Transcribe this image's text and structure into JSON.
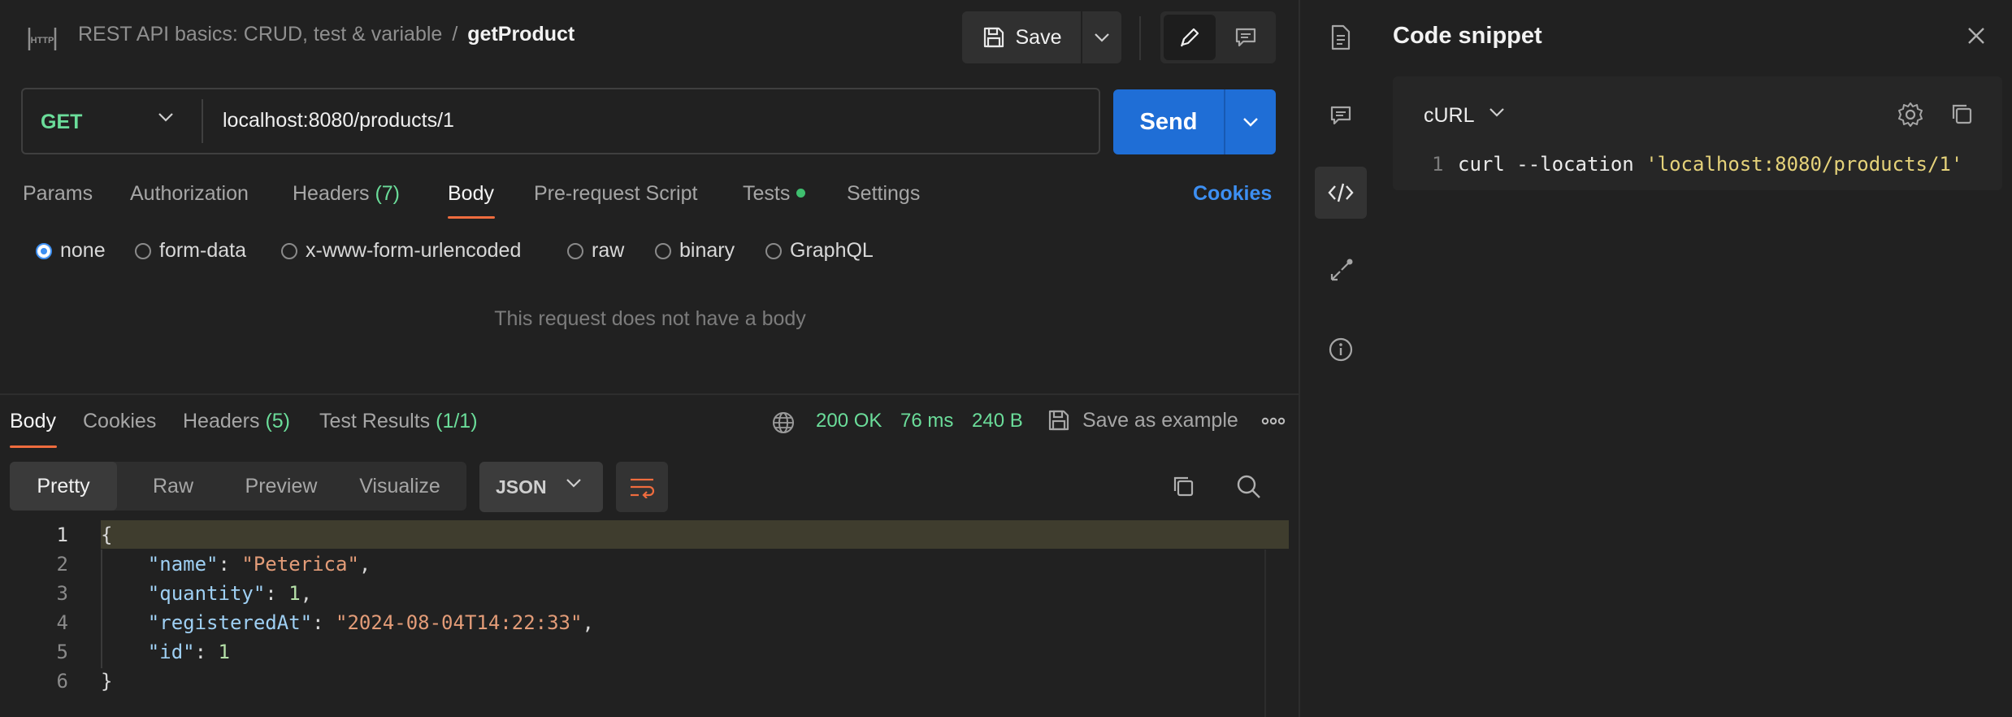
{
  "breadcrumb": {
    "collection": "REST API basics: CRUD, test & variable",
    "separator": "/",
    "request": "getProduct"
  },
  "toolbar": {
    "save_label": "Save"
  },
  "request": {
    "method": "GET",
    "url": "localhost:8080/products/1",
    "send_label": "Send",
    "tabs": {
      "params": "Params",
      "authorization": "Authorization",
      "headers": "Headers",
      "headers_count": "(7)",
      "body": "Body",
      "prerequest": "Pre-request Script",
      "tests": "Tests",
      "settings": "Settings"
    },
    "cookies_label": "Cookies",
    "body_types": [
      "none",
      "form-data",
      "x-www-form-urlencoded",
      "raw",
      "binary",
      "GraphQL"
    ],
    "selected_body_type": "none",
    "empty_body_message": "This request does not have a body"
  },
  "response": {
    "tabs": {
      "body": "Body",
      "cookies": "Cookies",
      "headers": "Headers",
      "headers_count": "(5)",
      "test_results": "Test Results",
      "test_results_count": "(1/1)"
    },
    "status": "200 OK",
    "time": "76 ms",
    "size": "240 B",
    "save_example_label": "Save as example",
    "views": [
      "Pretty",
      "Raw",
      "Preview",
      "Visualize"
    ],
    "format": "JSON",
    "line_numbers": [
      "1",
      "2",
      "3",
      "4",
      "5",
      "6"
    ],
    "json": {
      "open": "{",
      "name_key": "\"name\"",
      "name_val": "\"Peterica\"",
      "quantity_key": "\"quantity\"",
      "quantity_val": "1",
      "registered_key": "\"registeredAt\"",
      "registered_val": "\"2024-08-04T14:22:33\"",
      "id_key": "\"id\"",
      "id_val": "1",
      "close": "}"
    }
  },
  "snippet": {
    "title": "Code snippet",
    "language": "cURL",
    "line_number": "1",
    "code_cmd": "curl --location ",
    "code_arg": "'localhost:8080/products/1'"
  },
  "colors": {
    "accent_orange": "#ef6c3e",
    "send_blue": "#1f6ed6",
    "link_blue": "#3d8ff2",
    "method_green": "#6bdd9a"
  }
}
